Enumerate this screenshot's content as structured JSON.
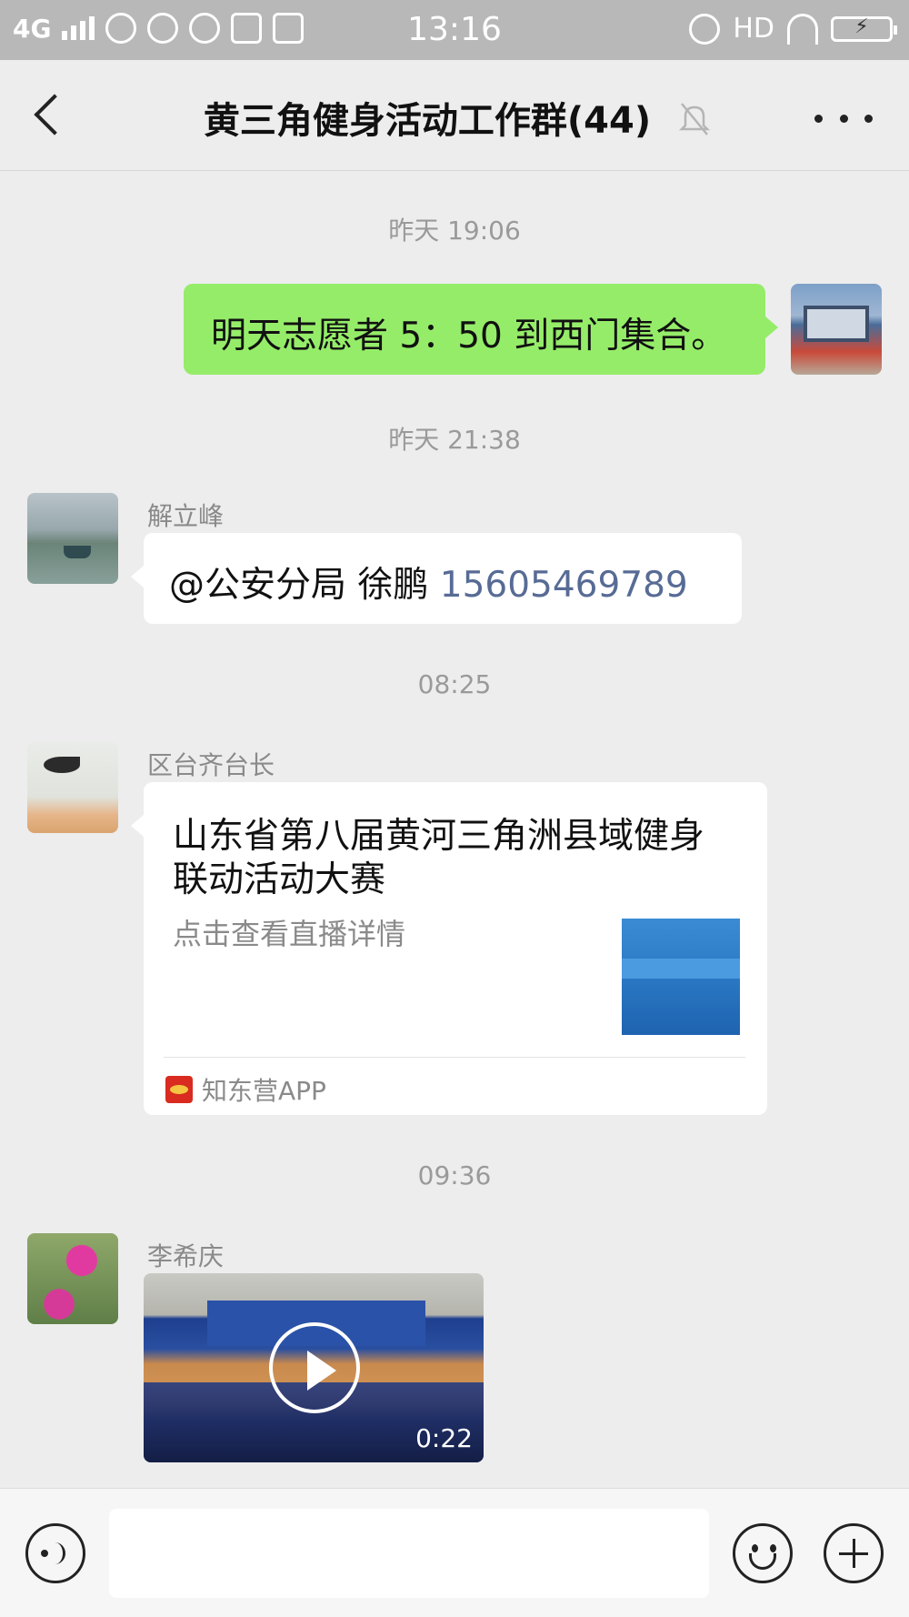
{
  "status_bar": {
    "network": "4G",
    "time": "13:16",
    "hd": "HD"
  },
  "header": {
    "title": "黄三角健身活动工作群(44)"
  },
  "messages": [
    {
      "timestamp": "昨天 19:06",
      "from": "self",
      "text": "明天志愿者 5：50 到西门集合。"
    },
    {
      "timestamp": "昨天 21:38",
      "sender": "解立峰",
      "text_prefix": "@公安分局 徐鹏 ",
      "phone": "15605469789"
    },
    {
      "timestamp": "08:25",
      "sender": "区台齐台长",
      "card": {
        "title": "山东省第八届黄河三角洲县域健身联动活动大赛",
        "description": "点击查看直播详情",
        "source": "知东营APP"
      }
    },
    {
      "timestamp": "09:36",
      "sender": "李希庆",
      "video": {
        "duration": "0:22"
      }
    }
  ],
  "input_bar": {
    "placeholder": ""
  },
  "icons": {
    "back": "back-arrow-icon",
    "mute": "bell-off-icon",
    "more": "more-dots-icon",
    "voice": "voice-icon",
    "emoji": "emoji-icon",
    "plus": "plus-icon",
    "play": "play-icon"
  },
  "colors": {
    "self_bubble": "#95ec69",
    "other_bubble": "#ffffff",
    "background": "#ededed",
    "link": "#576b95"
  }
}
